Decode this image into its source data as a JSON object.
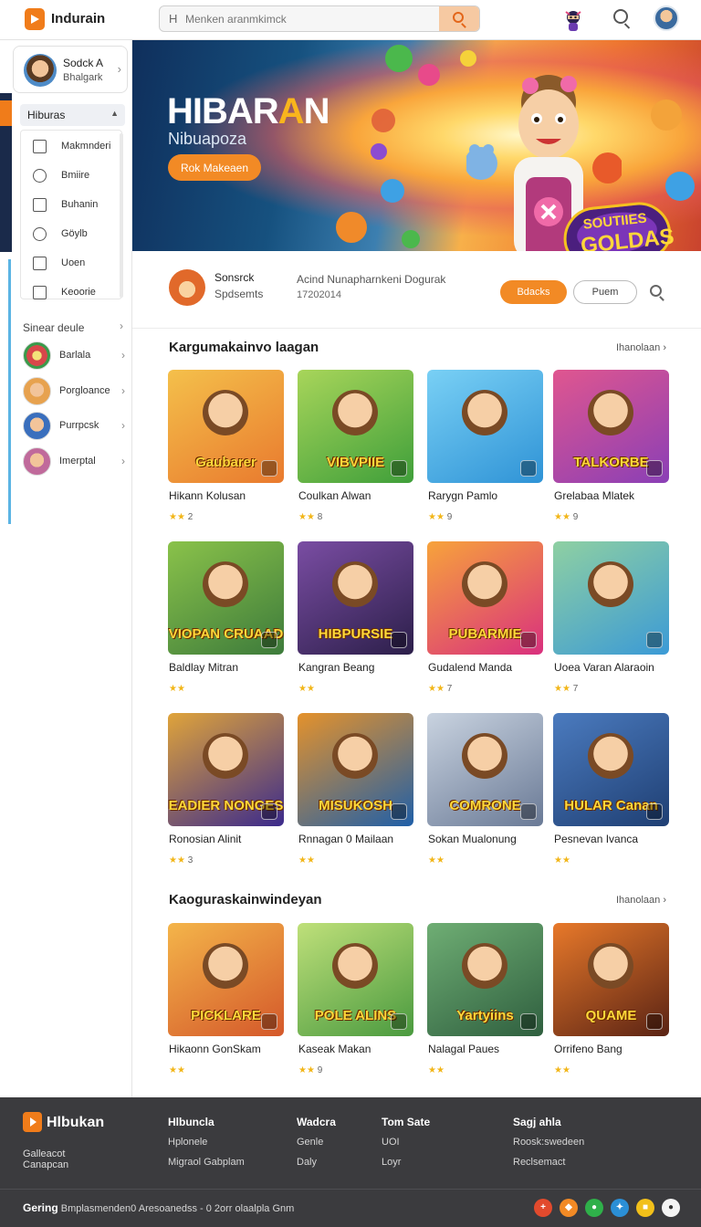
{
  "app": {
    "name": "Indurain"
  },
  "search": {
    "placeholder": "Menken aranmkimck",
    "hash": "H"
  },
  "sidebar": {
    "profile": {
      "name": "Sodck A",
      "sub": "Bhalgark"
    },
    "category_header": "Hiburas",
    "menu": [
      {
        "label": "Makmnderi",
        "icon": "gamepad-icon"
      },
      {
        "label": "Bmiire",
        "icon": "clock-icon"
      },
      {
        "label": "Buhanin",
        "icon": "square-icon"
      },
      {
        "label": "Göylb",
        "icon": "compass-icon"
      },
      {
        "label": "Uoen",
        "icon": "grid-icon"
      },
      {
        "label": "Keoorie",
        "icon": "home-icon"
      }
    ],
    "section_header": "Sinear deule",
    "games": [
      {
        "label": "Barlala",
        "color": "#d8474a"
      },
      {
        "label": "Porgloance",
        "color": "#e7a24f"
      },
      {
        "label": "Purrpcsk",
        "color": "#3a6fbd"
      },
      {
        "label": "Imerptal",
        "color": "#c06a9b"
      }
    ]
  },
  "hero": {
    "title_part1": "HIBAR",
    "title_hl": "A",
    "title_part2": "N",
    "subtitle": "Nibuapoza",
    "cta": "Rok Makeaen",
    "badge_line1": "SOUTIIES",
    "badge_line2": "GOLDAS"
  },
  "featured": {
    "name": "Sonsrck",
    "sub": "Spdsemts",
    "desc": "Acind Nunapharnkeni Dogurak",
    "date": "17202014",
    "primary_button": "Bdacks",
    "outline_button": "Puem"
  },
  "sections": [
    {
      "title": "Kargumakainvo laagan",
      "more": "Ihanolaan ›",
      "cards": [
        {
          "title": "Hikann Kolusan",
          "thumb_text": "Gaubarer",
          "rating": "2",
          "bg1": "#e97a2e",
          "bg2": "#f4c04b"
        },
        {
          "title": "Coulkan Alwan",
          "thumb_text": "VIBVPIIE",
          "rating": "8",
          "bg1": "#3f9f3a",
          "bg2": "#a8d55a"
        },
        {
          "title": "Rarygn Pamlo",
          "thumb_text": "",
          "rating": "9",
          "bg1": "#2f93d6",
          "bg2": "#79d0f5"
        },
        {
          "title": "Grelabaa Mlatek",
          "thumb_text": "TALKORBE",
          "rating": "9",
          "bg1": "#8a3fb6",
          "bg2": "#e0568f"
        },
        {
          "title": "Baldlay Mitran",
          "thumb_text": "VIOPAN CRUAAD",
          "rating": "",
          "bg1": "#3d7b3b",
          "bg2": "#8ac24a"
        },
        {
          "title": "Kangran Beang",
          "thumb_text": "HIBPURSIE",
          "rating": "",
          "bg1": "#2c1f4a",
          "bg2": "#7a4da3"
        },
        {
          "title": "Gudalend Manda",
          "thumb_text": "PUBARMIE",
          "rating": "7",
          "bg1": "#d9307e",
          "bg2": "#f7a33b"
        },
        {
          "title": "Uoea Varan Alaraoin",
          "thumb_text": "",
          "rating": "7",
          "bg1": "#3b9ad6",
          "bg2": "#8fd0a2"
        },
        {
          "title": "Ronosian Alinit",
          "thumb_text": "EADIER NONGES",
          "rating": "3",
          "bg1": "#3b2a8c",
          "bg2": "#e0a43a"
        },
        {
          "title": "Rnnagan 0 Mailaan",
          "thumb_text": "MISUKOSH",
          "rating": "",
          "bg1": "#1f5fa8",
          "bg2": "#e5922b"
        },
        {
          "title": "Sokan Mualonung",
          "thumb_text": "COMRONE",
          "rating": "",
          "bg1": "#6a7a96",
          "bg2": "#c9d3e0"
        },
        {
          "title": "Pesnevan Ivanca",
          "thumb_text": "HULAR Canan",
          "rating": "",
          "bg1": "#1f3f73",
          "bg2": "#4b7bbf"
        }
      ]
    },
    {
      "title": "Kaoguraskainwindeyan",
      "more": "Ihanolaan ›",
      "cards": [
        {
          "title": "Hikaonn GonSkam",
          "thumb_text": "PICKLARE",
          "rating": "",
          "bg1": "#d4582a",
          "bg2": "#f4b54a"
        },
        {
          "title": "Kaseak Makan",
          "thumb_text": "POLE ALINS",
          "rating": "9",
          "bg1": "#4a9a3f",
          "bg2": "#bfe07a"
        },
        {
          "title": "Nalagal Paues",
          "thumb_text": "Yartyiins",
          "rating": "",
          "bg1": "#2f5f3f",
          "bg2": "#6fae74"
        },
        {
          "title": "Orrifeno Bang",
          "thumb_text": "QUAME",
          "rating": "",
          "bg1": "#5a2314",
          "bg2": "#e8792a"
        }
      ]
    }
  ],
  "footer": {
    "brand": "Hlbukan",
    "tag1": "Galleacot",
    "tag2": "Canapcan",
    "cols": [
      {
        "head": "Hlbuncla",
        "links": [
          "Hplonele",
          "Migraol Gabplam"
        ]
      },
      {
        "head": "Wadcra",
        "links": [
          "Genle",
          "Daly"
        ]
      },
      {
        "head": "Tom Sate",
        "links": [
          "UOI",
          "Loyr"
        ]
      },
      {
        "head": "Sagj ahla",
        "links": [
          "Roosk:swedeen",
          "Reclsemact"
        ]
      }
    ],
    "bottom_bold": "Gering",
    "bottom_text": "Bmplasmenden0  Aresoanedss - 0 2orr olaalpla Gnm",
    "social": [
      {
        "icon": "plus-social-icon",
        "color": "#e24a2d",
        "glyph": "+"
      },
      {
        "icon": "orange-social-icon",
        "color": "#f28a25",
        "glyph": "◆"
      },
      {
        "icon": "chat-social-icon",
        "color": "#2fb04a",
        "glyph": "●"
      },
      {
        "icon": "bird-social-icon",
        "color": "#2b8fd6",
        "glyph": "✦"
      },
      {
        "icon": "yellow-social-icon",
        "color": "#f2c01a",
        "glyph": "■"
      },
      {
        "icon": "white-social-icon",
        "color": "#f4f4f4",
        "glyph": "●"
      }
    ]
  }
}
